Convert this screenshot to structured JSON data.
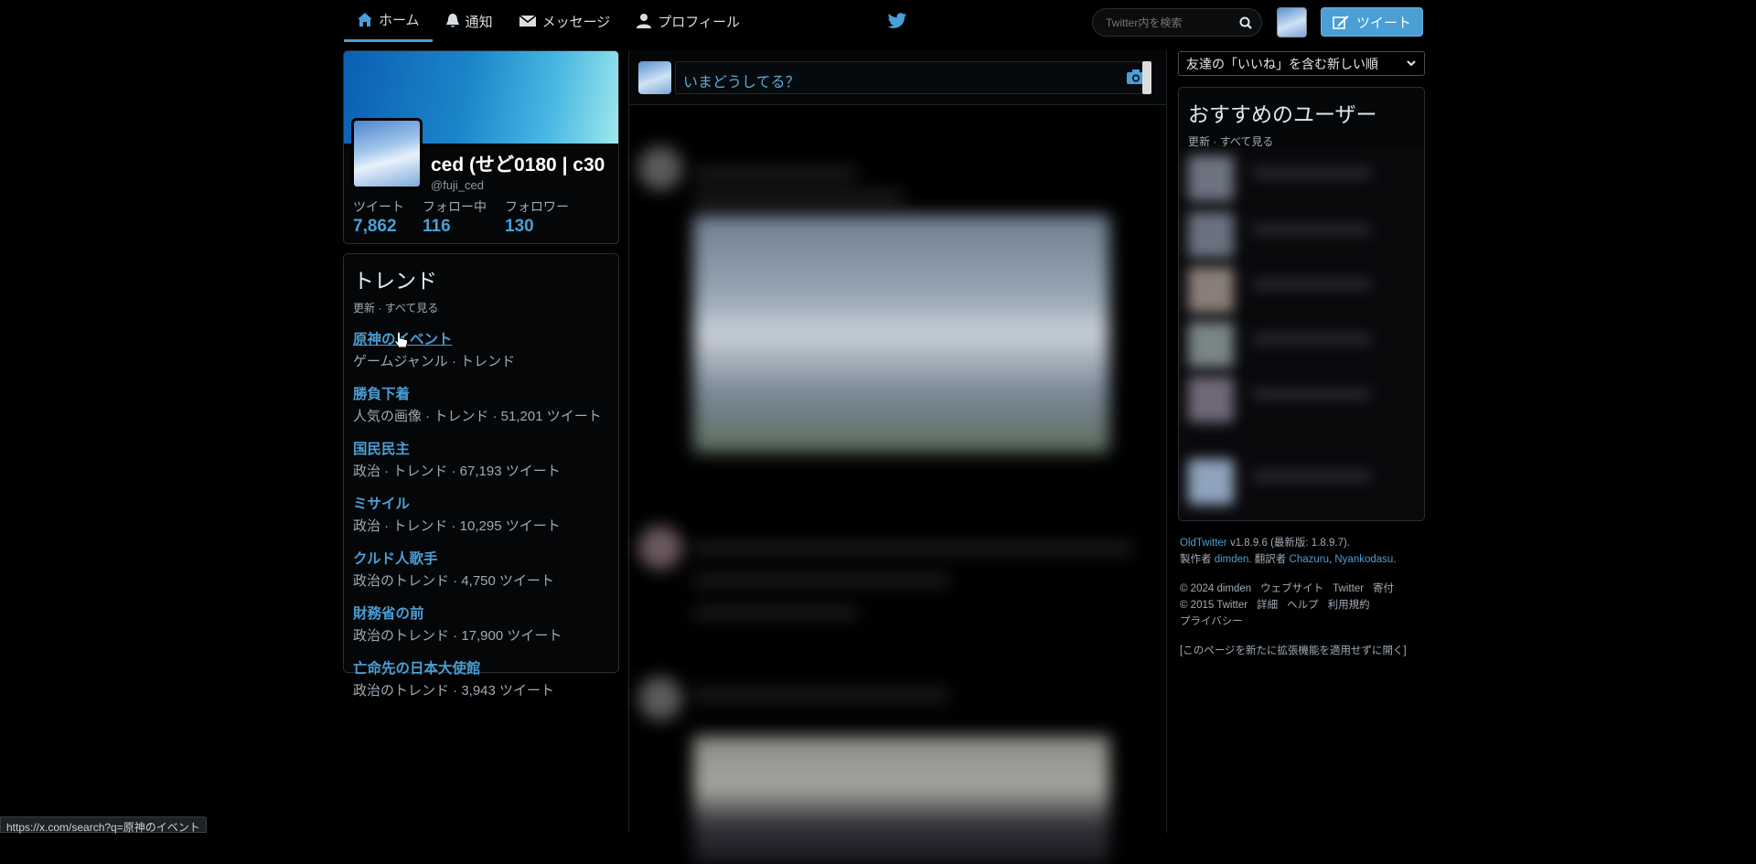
{
  "nav": {
    "home": "ホーム",
    "notifications": "通知",
    "messages": "メッセージ",
    "profile": "プロフィール",
    "search_placeholder": "Twitter内を検索",
    "tweet_button": "ツイート"
  },
  "profile": {
    "name": "ced (せど0180 | c30",
    "handle": "@fuji_ced",
    "stats": [
      {
        "label": "ツイート",
        "value": "7,862"
      },
      {
        "label": "フォロー中",
        "value": "116"
      },
      {
        "label": "フォロワー",
        "value": "130"
      }
    ]
  },
  "trends": {
    "title": "トレンド",
    "refresh": "更新",
    "sep": "·",
    "see_all": "すべて見る",
    "items": [
      {
        "name": "原神のイベント",
        "meta": "ゲームジャンル · トレンド"
      },
      {
        "name": "勝負下着",
        "meta": "人気の画像 · トレンド · 51,201 ツイート"
      },
      {
        "name": "国民民主",
        "meta": "政治 · トレンド · 67,193 ツイート"
      },
      {
        "name": "ミサイル",
        "meta": "政治 · トレンド · 10,295 ツイート"
      },
      {
        "name": "クルド人歌手",
        "meta": "政治のトレンド · 4,750 ツイート"
      },
      {
        "name": "財務省の前",
        "meta": "政治のトレンド · 17,900 ツイート"
      },
      {
        "name": "亡命先の日本大使館",
        "meta": "政治のトレンド · 3,943 ツイート"
      }
    ]
  },
  "compose": {
    "placeholder": "いまどうしてる？"
  },
  "timeline": {
    "sort_selected": "友達の「いいね」を含む新しい順"
  },
  "suggestions": {
    "title": "おすすめのユーザー",
    "refresh": "更新",
    "sep": "·",
    "see_all": "すべて見る"
  },
  "footer": {
    "app_name": "OldTwitter",
    "version": " v1.8.9.6 (最新版: 1.8.9.7).",
    "made_by": "製作者 ",
    "author": "dimden",
    "translated_by": ". 翻訳者 ",
    "translator1": "Chazuru",
    "comma": ", ",
    "translator2": "Nyankodasu",
    "dot": ".",
    "copyright_dimden": "© 2024 dimden",
    "website": "ウェブサイト",
    "twitter": "Twitter",
    "donate": "寄付",
    "copyright_twitter": "© 2015 Twitter",
    "details": "詳細",
    "help": "ヘルプ",
    "terms": "利用規約",
    "privacy": "プライバシー",
    "open_without": "[このページを新たに拡張機能を適用せずに開く]"
  },
  "status_url": "https://x.com/search?q=原神のイベント",
  "colors": {
    "accent": "#4a9fd6",
    "background": "#000000"
  }
}
